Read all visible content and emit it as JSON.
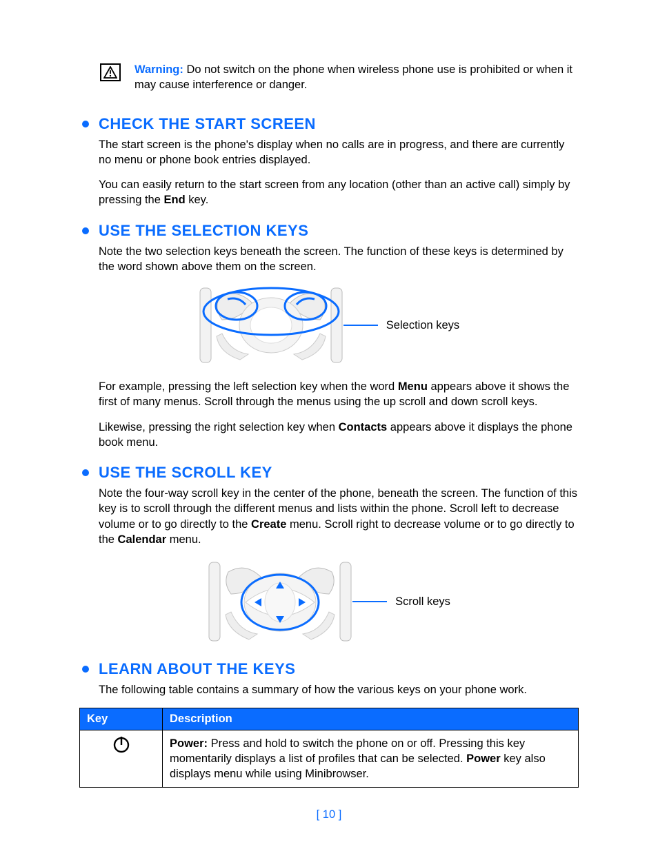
{
  "warning": {
    "label": "Warning:",
    "text": " Do not switch on the phone when wireless phone use is prohibited or when it may cause interference or danger."
  },
  "sections": {
    "check": {
      "title": "CHECK THE START SCREEN",
      "p1": "The start screen is the phone's display when no calls are in progress, and there are currently no menu or phone book entries displayed.",
      "p2a": "You can easily return to the start screen from any location (other than an active call) simply by pressing the ",
      "p2b": "End",
      "p2c": " key."
    },
    "selection": {
      "title": "USE THE SELECTION KEYS",
      "p1": "Note the two selection keys beneath the screen. The function of these keys is determined by the word shown above them on the screen.",
      "callout": "Selection keys",
      "p2a": "For example, pressing the left selection key when the word ",
      "p2b": "Menu",
      "p2c": " appears above it shows the first of many menus. Scroll through the menus using the up scroll and down scroll keys.",
      "p3a": "Likewise, pressing the right selection key when ",
      "p3b": "Contacts",
      "p3c": " appears above it displays the phone book menu."
    },
    "scroll": {
      "title": "USE THE SCROLL KEY",
      "p1a": "Note the four-way scroll key in the center of the phone, beneath the screen. The function of this key is to scroll through the different menus and lists within the phone. Scroll left to decrease volume or to go directly to the ",
      "p1b": "Create",
      "p1c": " menu. Scroll right to decrease volume or to go directly to the ",
      "p1d": "Calendar",
      "p1e": " menu.",
      "callout": "Scroll keys"
    },
    "learn": {
      "title": "LEARN ABOUT THE KEYS",
      "p1": "The following table contains a summary of how the various keys on your phone work."
    }
  },
  "table": {
    "header_key": "Key",
    "header_desc": "Description",
    "rows": [
      {
        "icon": "power",
        "d1": "Power:",
        "d2": " Press and hold to switch the phone on or off. Pressing this key momentarily displays a list of profiles that can be selected. ",
        "d3": "Power",
        "d4": " key also displays menu while using Minibrowser."
      }
    ]
  },
  "page_number": "[ 10 ]"
}
